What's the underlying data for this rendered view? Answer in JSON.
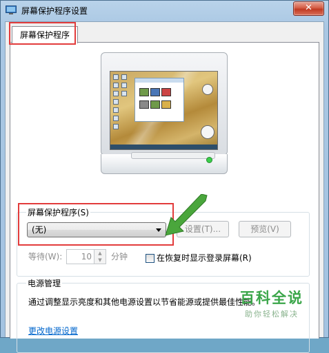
{
  "window": {
    "title": "屏幕保护程序设置",
    "close_label": "✕"
  },
  "tab": {
    "label": "屏幕保护程序"
  },
  "screensaver": {
    "group_label": "屏幕保护程序(S)",
    "selected": "(无)",
    "settings_label": "设置(T)...",
    "preview_label": "预览(V)",
    "wait_label": "等待(W):",
    "wait_value": "10",
    "minutes_label": "分钟",
    "resume_label": "在恢复时显示登录屏幕(R)",
    "resume_checked": false
  },
  "power": {
    "group_label": "电源管理",
    "description": "通过调整显示亮度和其他电源设置以节省能源或提供最佳性能。",
    "link_label": "更改电源设置"
  },
  "watermark": {
    "title": "百科全说",
    "subtitle": "助你轻松解决"
  },
  "colors": {
    "highlight_box": "#e23b3b",
    "arrow": "#4aa63c",
    "link": "#0066cc"
  }
}
